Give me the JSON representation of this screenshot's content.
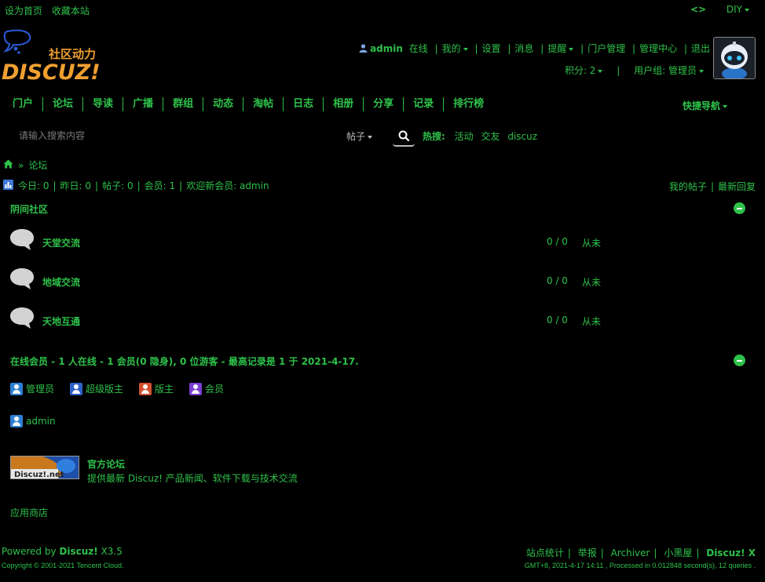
{
  "topbar": {
    "set_home": "设为首页",
    "bookmark": "收藏本站",
    "code_icon": "<>",
    "diy": "DIY"
  },
  "logo": {
    "subtitle": "社区动力",
    "brand": "DISCUZ!"
  },
  "user": {
    "name": "admin",
    "status": "在线",
    "links": [
      "我的",
      "设置",
      "消息",
      "提醒",
      "门户管理",
      "管理中心",
      "退出"
    ],
    "credits": "积分: 2",
    "group": "用户组: 管理员"
  },
  "nav": {
    "items": [
      "门户",
      "论坛",
      "导读",
      "广播",
      "群组",
      "动态",
      "淘帖",
      "日志",
      "相册",
      "分享",
      "记录",
      "排行榜"
    ],
    "quick_nav": "快捷导航"
  },
  "search": {
    "placeholder": "请输入搜索内容",
    "type": "帖子",
    "hot_label": "热搜:",
    "hot_terms": [
      "活动",
      "交友",
      "discuz"
    ]
  },
  "breadcrumb": {
    "sep": "»",
    "current": "论坛"
  },
  "stats": {
    "today": "今日: 0",
    "yesterday": "昨日: 0",
    "posts": "帖子: 0",
    "members": "会员: 1",
    "welcome": "欢迎新会员: admin",
    "my_posts": "我的帖子",
    "latest_replies": "最新回复"
  },
  "category": {
    "title": "阴间社区",
    "forums": [
      {
        "name": "天堂交流",
        "counts": "0 / 0",
        "last": "从未"
      },
      {
        "name": "地域交流",
        "counts": "0 / 0",
        "last": "从未"
      },
      {
        "name": "天地互通",
        "counts": "0 / 0",
        "last": "从未"
      }
    ]
  },
  "online": {
    "title": "在线会员 - 1 人在线 - 1 会员(0 隐身), 0 位游客 - 最高记录是 1 于 2021-4-17.",
    "legend": [
      {
        "label": "管理员",
        "color": "#2d7fd4"
      },
      {
        "label": "超级版主",
        "color": "#2f62c9"
      },
      {
        "label": "版主",
        "color": "#d2502d"
      },
      {
        "label": "会员",
        "color": "#7a3ed0"
      }
    ],
    "users": [
      "admin"
    ]
  },
  "partner": {
    "logo_text": "Discuz!.net",
    "title": "官方论坛",
    "desc": "提供最新 Discuz! 产品新闻、软件下载与技术交流"
  },
  "appstore": "应用商店",
  "footer": {
    "powered_prefix": "Powered by",
    "powered_brand": "Discuz!",
    "version": "X3.5",
    "copyright": "Copyright © 2001-2021 Tencent Cloud.",
    "links": [
      "站点统计",
      "举报",
      "Archiver",
      "小黑屋"
    ],
    "brand_link": "Discuz! X",
    "info": "GMT+8, 2021-4-17 14:11 , Processed in 0.012848 second(s), 12 queries ."
  },
  "colors": {
    "accent": "#2ec14a",
    "background": "#000000"
  }
}
